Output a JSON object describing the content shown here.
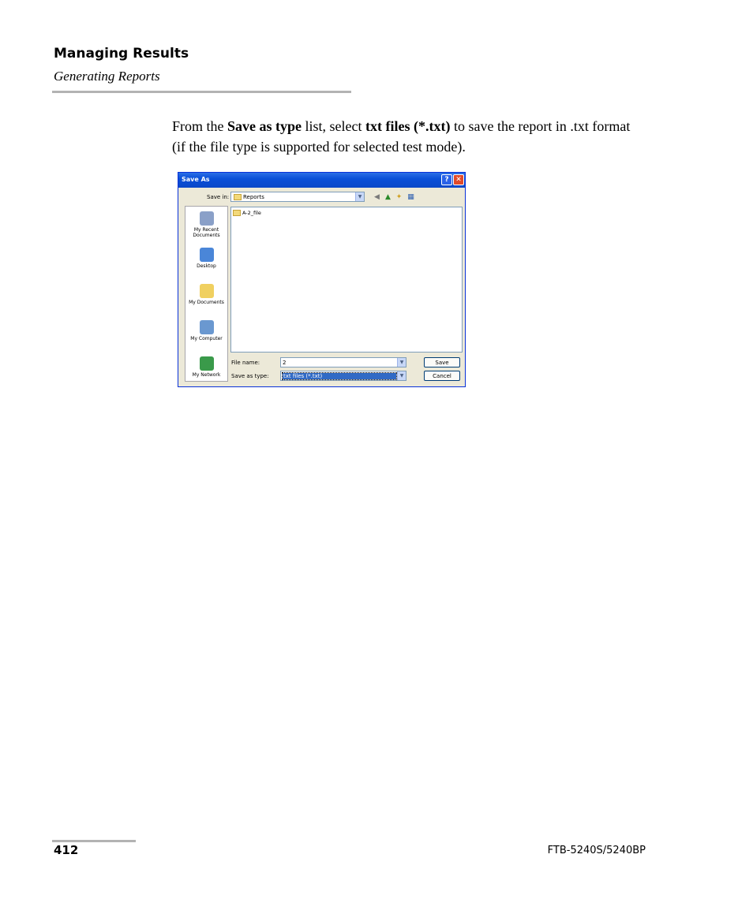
{
  "header": {
    "title": "Managing Results",
    "subtitle": "Generating Reports"
  },
  "body": {
    "text_1": "From the ",
    "bold_1": "Save as type",
    "text_2": " list, select ",
    "bold_2": "txt files (*.txt)",
    "text_3": " to save the report in .txt format (if the file type is supported for selected test mode)."
  },
  "dialog": {
    "title": "Save As",
    "help_glyph": "?",
    "close_glyph": "✕",
    "save_in_label": "Save in:",
    "save_in_value": "Reports",
    "places": [
      {
        "label": "My Recent Documents",
        "icon": "recent-documents-icon",
        "color": "#8aa0c8"
      },
      {
        "label": "Desktop",
        "icon": "desktop-icon",
        "color": "#4a86d8"
      },
      {
        "label": "My Documents",
        "icon": "my-documents-icon",
        "color": "#f0d060"
      },
      {
        "label": "My Computer",
        "icon": "my-computer-icon",
        "color": "#6a98d0"
      },
      {
        "label": "My Network",
        "icon": "my-network-icon",
        "color": "#3a9a4a"
      }
    ],
    "files": [
      {
        "name": "A-2_file",
        "icon": "folder-icon"
      }
    ],
    "file_name_label": "File name:",
    "file_name_value": "2",
    "save_as_type_label": "Save as type:",
    "save_as_type_value": "txt files (*.txt)",
    "save_button": "Save",
    "cancel_button": "Cancel"
  },
  "footer": {
    "page_number": "412",
    "product": "FTB-5240S/5240BP"
  }
}
